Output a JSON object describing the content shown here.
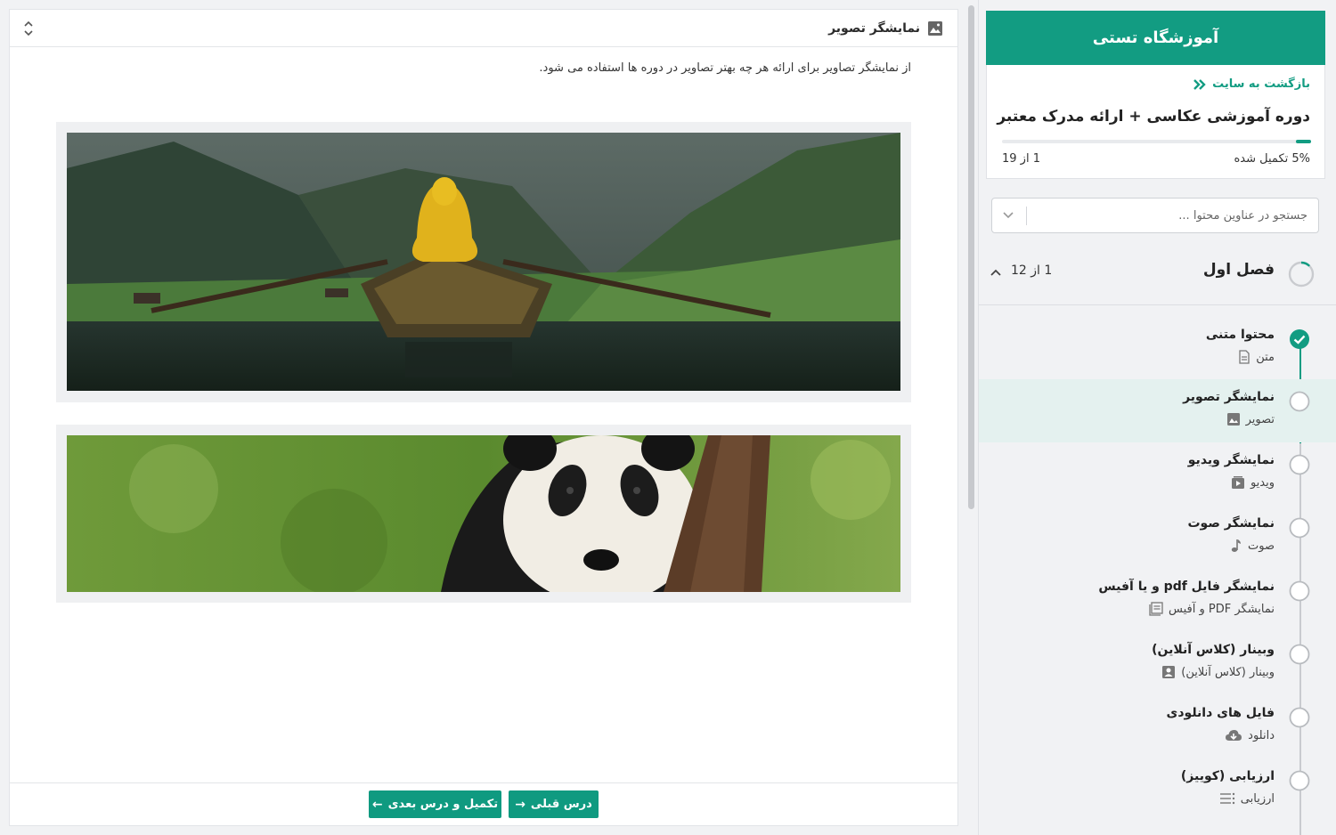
{
  "main": {
    "header_title": "نمایشگر تصویر",
    "description": "از نمایشگر تصاویر برای ارائه هر چه بهتر تصاویر در دوره ها استفاده می شود.",
    "images": [
      {
        "icon": "boat-lake-image"
      },
      {
        "icon": "panda-image"
      }
    ],
    "prev_button": "درس قبلی",
    "next_button": "تکمیل و درس بعدی"
  },
  "sidebar": {
    "school_name": "آموزشگاه تستی",
    "back_link": "بازگشت به سایت",
    "course_title": "دوره آموزشی عکاسی + ارائه مدرک معتبر",
    "progress_percent": 5,
    "progress_label": "5% تکمیل شده",
    "progress_count": "1 از 19",
    "search_placeholder": "جستجو در عناوین محتوا ...",
    "chapter": {
      "title": "فصل اول",
      "count": "1 از 12"
    },
    "lessons": [
      {
        "title": "محتوا متنی",
        "type": "متن",
        "icon": "document-icon",
        "status": "completed"
      },
      {
        "title": "نمایشگر تصویر",
        "type": "تصویر",
        "icon": "image-icon",
        "status": "active"
      },
      {
        "title": "نمایشگر ویدیو",
        "type": "ویدیو",
        "icon": "video-icon",
        "status": "pending"
      },
      {
        "title": "نمایشگر صوت",
        "type": "صوت",
        "icon": "music-note-icon",
        "status": "pending"
      },
      {
        "title": "نمایشگر فایل pdf و یا آفیس",
        "type": "نمایشگر PDF و آفیس",
        "icon": "file-viewer-icon",
        "status": "pending"
      },
      {
        "title": "وبینار (کلاس آنلاین)",
        "type": "وبینار (کلاس آنلاین)",
        "icon": "webinar-icon",
        "status": "pending"
      },
      {
        "title": "فایل های دانلودی",
        "type": "دانلود",
        "icon": "cloud-download-icon",
        "status": "pending"
      },
      {
        "title": "ارزیابی (کوییز)",
        "type": "ارزیابی",
        "icon": "quiz-icon",
        "status": "pending"
      }
    ]
  },
  "colors": {
    "accent": "#129c82",
    "active_row": "#e4f1ef",
    "background": "#f1f2f4"
  }
}
